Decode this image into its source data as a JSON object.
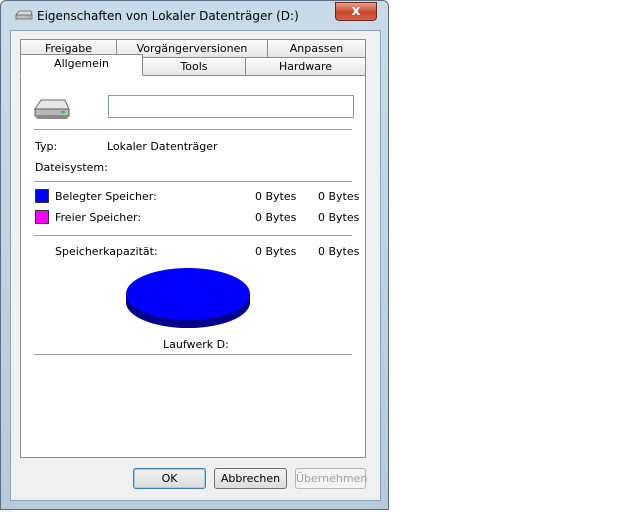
{
  "window": {
    "title": "Eigenschaften von Lokaler Datenträger (D:)",
    "close_glyph": "x"
  },
  "tabs_row1": [
    "Freigabe",
    "Vorgängerversionen",
    "Anpassen"
  ],
  "tabs_row2": [
    "Allgemein",
    "Tools",
    "Hardware"
  ],
  "active_tab": "Allgemein",
  "general": {
    "drive_name_value": "",
    "type_label": "Typ:",
    "type_value": "Lokaler Datenträger",
    "filesystem_label": "Dateisystem:",
    "filesystem_value": "",
    "used_label": "Belegter Speicher:",
    "used_bytes": "0 Bytes",
    "used_size": "0 Bytes",
    "free_label": "Freier Speicher:",
    "free_bytes": "0 Bytes",
    "free_size": "0 Bytes",
    "capacity_label": "Speicherkapazität:",
    "capacity_bytes": "0 Bytes",
    "capacity_size": "0 Bytes",
    "drive_label": "Laufwerk D:"
  },
  "colors": {
    "used": "#0000ff",
    "free": "#ff00ff",
    "pie_top": "#0000ff",
    "pie_side": "#00008b"
  },
  "buttons": {
    "ok": "OK",
    "cancel": "Abbrechen",
    "apply": "Übernehmen"
  },
  "icons": {
    "title": "drive-icon",
    "drive": "hard-drive-icon"
  }
}
